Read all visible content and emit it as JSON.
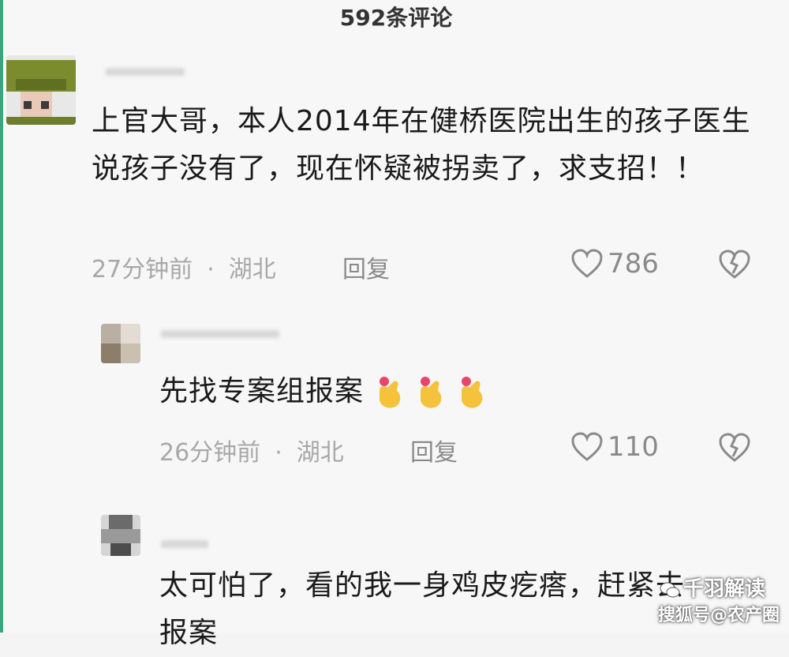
{
  "header": {
    "title": "592条评论"
  },
  "comments": [
    {
      "text": "上官大哥，本人2014年在健桥医院出生的孩子医生说孩子没有了，现在怀疑被拐卖了，求支招！！",
      "time": "27分钟前",
      "location": "湖北",
      "reply_label": "回复",
      "likes": "786"
    },
    {
      "text": "先找专案组报案",
      "time": "26分钟前",
      "location": "湖北",
      "reply_label": "回复",
      "likes": "110"
    },
    {
      "text": "太可怕了，看的我一身鸡皮疙瘩，赶紧去报案"
    }
  ],
  "meta_separator": "·",
  "watermark": {
    "line1": "千羽解读",
    "line2": "搜狐号@农产圈"
  },
  "colors": {
    "accent_edge": "#3fa37e",
    "emoji": "#f5c33b",
    "emoji_heart": "#e8456b"
  }
}
